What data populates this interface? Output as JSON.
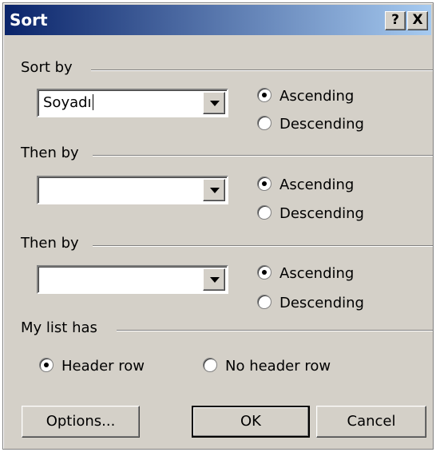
{
  "title": "Sort",
  "titlebar": {
    "help": "?",
    "close": "X"
  },
  "sort_by": {
    "label": "Sort by",
    "value": "Soyadı",
    "ascending": "Ascending",
    "descending": "Descending",
    "selected": "ascending"
  },
  "then_by_1": {
    "label": "Then by",
    "value": "",
    "ascending": "Ascending",
    "descending": "Descending",
    "selected": "ascending"
  },
  "then_by_2": {
    "label": "Then by",
    "value": "",
    "ascending": "Ascending",
    "descending": "Descending",
    "selected": "ascending"
  },
  "list_has": {
    "label": "My list has",
    "header_row": "Header row",
    "no_header_row": "No header row",
    "selected": "header_row"
  },
  "buttons": {
    "options": "Options...",
    "ok": "OK",
    "cancel": "Cancel"
  }
}
